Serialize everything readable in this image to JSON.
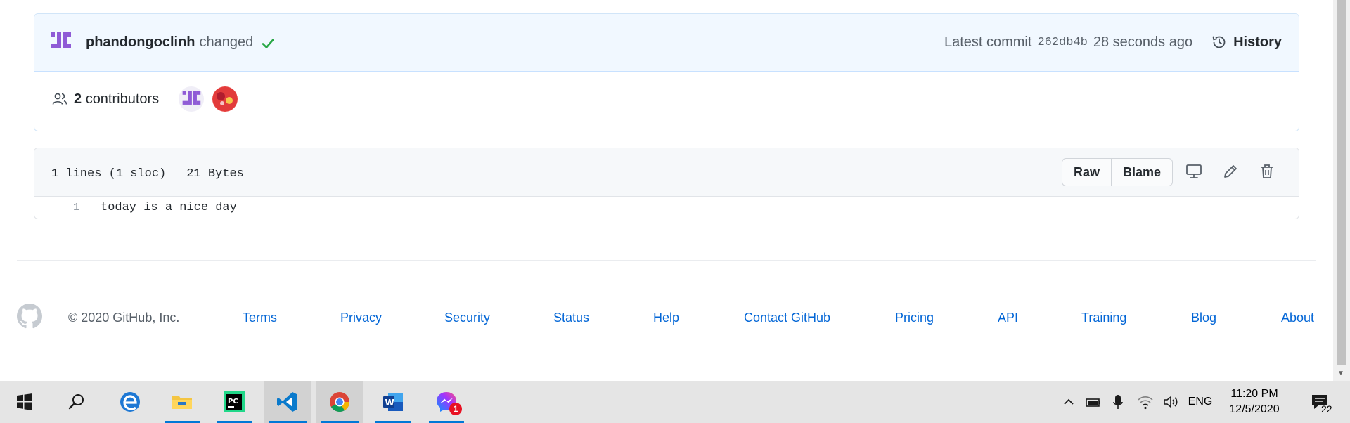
{
  "commit": {
    "author": "phandongoclinh",
    "message": "changed",
    "latest_label": "Latest commit",
    "sha": "262db4b",
    "time_ago": "28 seconds ago",
    "history_label": "History"
  },
  "contributors": {
    "count": "2",
    "label": "contributors"
  },
  "file": {
    "lines": "1 lines (1 sloc)",
    "size": "21 Bytes",
    "raw_label": "Raw",
    "blame_label": "Blame",
    "code_lines": [
      {
        "num": "1",
        "text": "today is a nice day"
      }
    ]
  },
  "footer": {
    "copyright": "© 2020 GitHub, Inc.",
    "links": [
      "Terms",
      "Privacy",
      "Security",
      "Status",
      "Help",
      "Contact GitHub",
      "Pricing",
      "API",
      "Training",
      "Blog",
      "About"
    ]
  },
  "taskbar": {
    "apps": [
      "windows-start",
      "search",
      "edge",
      "file-explorer",
      "pycharm",
      "vscode",
      "chrome",
      "word",
      "messenger"
    ],
    "messenger_badge": "1",
    "language": "ENG",
    "time": "11:20 PM",
    "date": "12/5/2020",
    "notifications": "22"
  },
  "colors": {
    "link": "#0366d6",
    "success": "#28a745",
    "commit_bg": "#f1f8ff",
    "taskbar_bg": "#e5e5e5",
    "accent": "#0078d7"
  }
}
